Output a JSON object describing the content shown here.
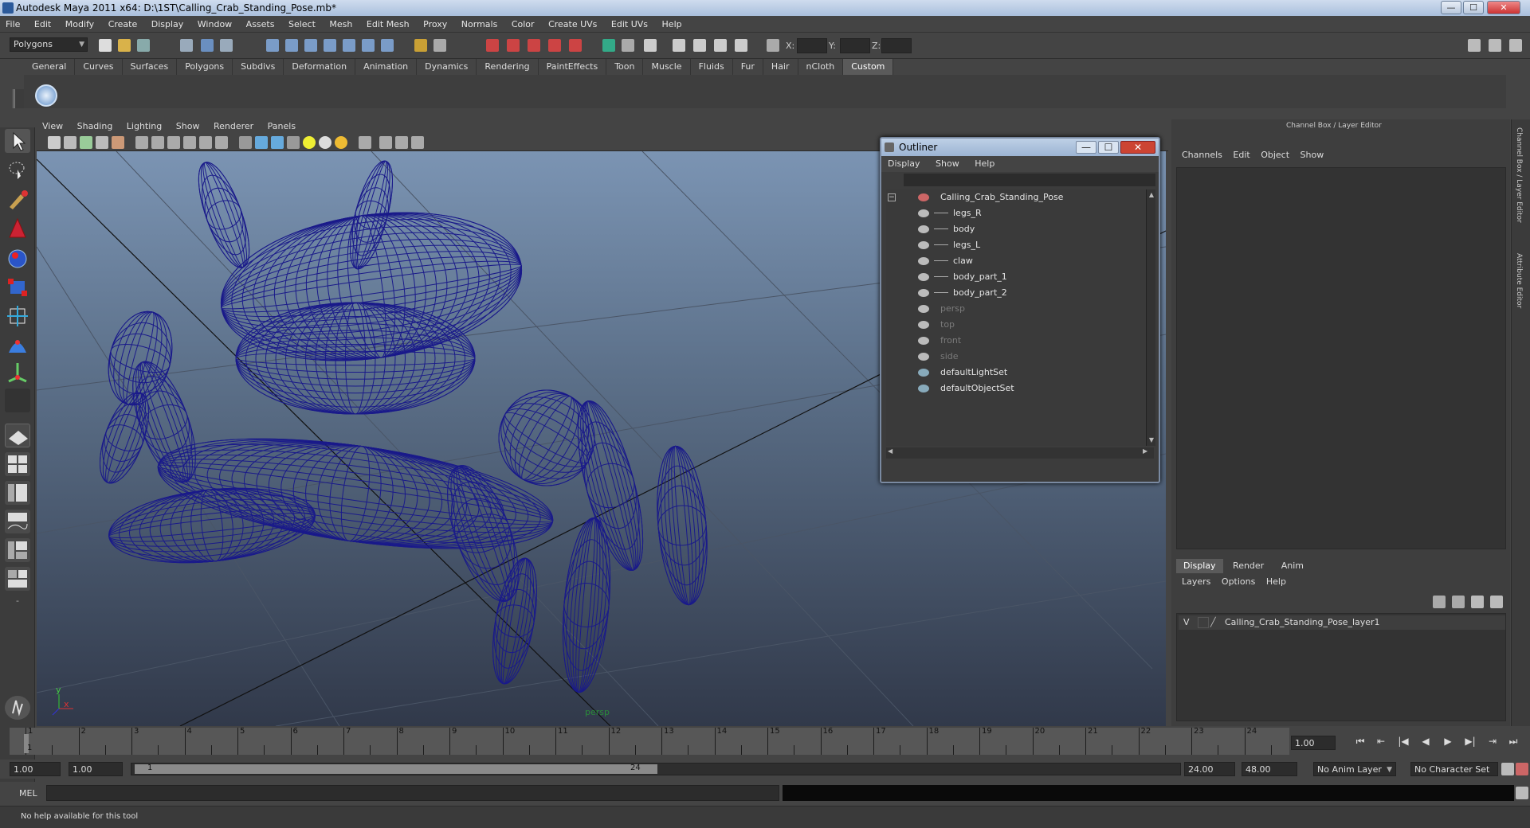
{
  "window": {
    "title": "Autodesk Maya 2011 x64: D:\\1ST\\Calling_Crab_Standing_Pose.mb*",
    "min": "—",
    "max": "☐",
    "close": "✕"
  },
  "menubar": [
    "File",
    "Edit",
    "Modify",
    "Create",
    "Display",
    "Window",
    "Assets",
    "Select",
    "Mesh",
    "Edit Mesh",
    "Proxy",
    "Normals",
    "Color",
    "Create UVs",
    "Edit UVs",
    "Help"
  ],
  "statusline": {
    "mode": "Polygons",
    "x_label": "X:",
    "y_label": "Y:",
    "z_label": "Z:"
  },
  "shelf": {
    "tabs": [
      "General",
      "Curves",
      "Surfaces",
      "Polygons",
      "Subdivs",
      "Deformation",
      "Animation",
      "Dynamics",
      "Rendering",
      "PaintEffects",
      "Toon",
      "Muscle",
      "Fluids",
      "Fur",
      "Hair",
      "nCloth",
      "Custom"
    ],
    "active_tab": "Custom"
  },
  "viewport": {
    "menu": [
      "View",
      "Shading",
      "Lighting",
      "Show",
      "Renderer",
      "Panels"
    ],
    "camera_label": "persp",
    "axis_y": "y",
    "axis_x": "x",
    "wire_color": "#1a1a8a"
  },
  "outliner": {
    "title": "Outliner",
    "menu": [
      "Display",
      "Show",
      "Help"
    ],
    "collapse_toggle": "−",
    "items": [
      {
        "label": "Calling_Crab_Standing_Pose",
        "dim": false
      },
      {
        "label": "legs_R",
        "dim": false
      },
      {
        "label": "body",
        "dim": false
      },
      {
        "label": "legs_L",
        "dim": false
      },
      {
        "label": "claw",
        "dim": false
      },
      {
        "label": "body_part_1",
        "dim": false
      },
      {
        "label": "body_part_2",
        "dim": false
      },
      {
        "label": "persp",
        "dim": true
      },
      {
        "label": "top",
        "dim": true
      },
      {
        "label": "front",
        "dim": true
      },
      {
        "label": "side",
        "dim": true
      },
      {
        "label": "defaultLightSet",
        "dim": false
      },
      {
        "label": "defaultObjectSet",
        "dim": false
      }
    ]
  },
  "channelbox": {
    "title": "Channel Box / Layer Editor",
    "menu": [
      "Channels",
      "Edit",
      "Object",
      "Show"
    ],
    "layer_tabs": [
      "Display",
      "Render",
      "Anim"
    ],
    "active_layer_tab": "Display",
    "layer_menu": [
      "Layers",
      "Options",
      "Help"
    ],
    "layer": {
      "visible": "V",
      "name": "Calling_Crab_Standing_Pose_layer1"
    },
    "side_tabs": [
      "Channel Box / Layer Editor",
      "Attribute Editor"
    ]
  },
  "timeline": {
    "frames": [
      "1",
      "2",
      "3",
      "4",
      "5",
      "6",
      "7",
      "8",
      "9",
      "10",
      "11",
      "12",
      "13",
      "14",
      "15",
      "16",
      "17",
      "18",
      "19",
      "20",
      "21",
      "22",
      "23",
      "24"
    ],
    "current_frame": "1",
    "current_time": "1.00"
  },
  "range": {
    "start_time": "1.00",
    "playback_start": "1.00",
    "slider_start": "1",
    "slider_end": "24",
    "playback_end": "24.00",
    "end_time": "48.00",
    "anim_layer": "No Anim Layer",
    "character_set": "No Character Set"
  },
  "playback": [
    "⏮",
    "⇤",
    "|◀",
    "◀",
    "▶",
    "▶|",
    "⇥",
    "⏭"
  ],
  "cmdline": {
    "label": "MEL"
  },
  "helpline": {
    "text": "No help available for this tool"
  }
}
